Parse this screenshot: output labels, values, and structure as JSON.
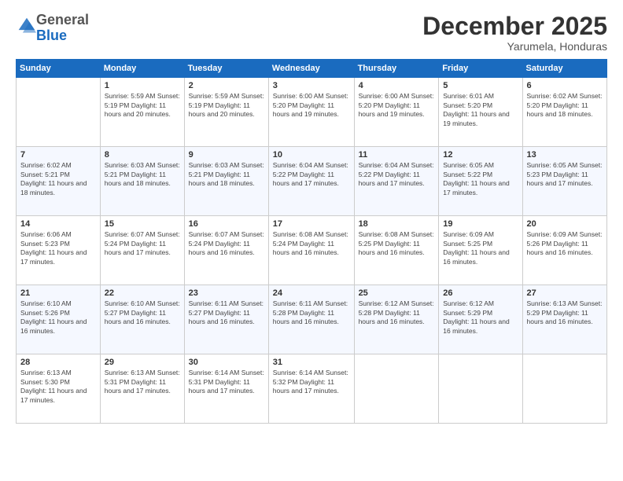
{
  "header": {
    "logo_general": "General",
    "logo_blue": "Blue",
    "month_title": "December 2025",
    "location": "Yarumela, Honduras"
  },
  "weekdays": [
    "Sunday",
    "Monday",
    "Tuesday",
    "Wednesday",
    "Thursday",
    "Friday",
    "Saturday"
  ],
  "weeks": [
    [
      {
        "day": "",
        "info": ""
      },
      {
        "day": "1",
        "info": "Sunrise: 5:59 AM\nSunset: 5:19 PM\nDaylight: 11 hours\nand 20 minutes."
      },
      {
        "day": "2",
        "info": "Sunrise: 5:59 AM\nSunset: 5:19 PM\nDaylight: 11 hours\nand 20 minutes."
      },
      {
        "day": "3",
        "info": "Sunrise: 6:00 AM\nSunset: 5:20 PM\nDaylight: 11 hours\nand 19 minutes."
      },
      {
        "day": "4",
        "info": "Sunrise: 6:00 AM\nSunset: 5:20 PM\nDaylight: 11 hours\nand 19 minutes."
      },
      {
        "day": "5",
        "info": "Sunrise: 6:01 AM\nSunset: 5:20 PM\nDaylight: 11 hours\nand 19 minutes."
      },
      {
        "day": "6",
        "info": "Sunrise: 6:02 AM\nSunset: 5:20 PM\nDaylight: 11 hours\nand 18 minutes."
      }
    ],
    [
      {
        "day": "7",
        "info": "Sunrise: 6:02 AM\nSunset: 5:21 PM\nDaylight: 11 hours\nand 18 minutes."
      },
      {
        "day": "8",
        "info": "Sunrise: 6:03 AM\nSunset: 5:21 PM\nDaylight: 11 hours\nand 18 minutes."
      },
      {
        "day": "9",
        "info": "Sunrise: 6:03 AM\nSunset: 5:21 PM\nDaylight: 11 hours\nand 18 minutes."
      },
      {
        "day": "10",
        "info": "Sunrise: 6:04 AM\nSunset: 5:22 PM\nDaylight: 11 hours\nand 17 minutes."
      },
      {
        "day": "11",
        "info": "Sunrise: 6:04 AM\nSunset: 5:22 PM\nDaylight: 11 hours\nand 17 minutes."
      },
      {
        "day": "12",
        "info": "Sunrise: 6:05 AM\nSunset: 5:22 PM\nDaylight: 11 hours\nand 17 minutes."
      },
      {
        "day": "13",
        "info": "Sunrise: 6:05 AM\nSunset: 5:23 PM\nDaylight: 11 hours\nand 17 minutes."
      }
    ],
    [
      {
        "day": "14",
        "info": "Sunrise: 6:06 AM\nSunset: 5:23 PM\nDaylight: 11 hours\nand 17 minutes."
      },
      {
        "day": "15",
        "info": "Sunrise: 6:07 AM\nSunset: 5:24 PM\nDaylight: 11 hours\nand 17 minutes."
      },
      {
        "day": "16",
        "info": "Sunrise: 6:07 AM\nSunset: 5:24 PM\nDaylight: 11 hours\nand 16 minutes."
      },
      {
        "day": "17",
        "info": "Sunrise: 6:08 AM\nSunset: 5:24 PM\nDaylight: 11 hours\nand 16 minutes."
      },
      {
        "day": "18",
        "info": "Sunrise: 6:08 AM\nSunset: 5:25 PM\nDaylight: 11 hours\nand 16 minutes."
      },
      {
        "day": "19",
        "info": "Sunrise: 6:09 AM\nSunset: 5:25 PM\nDaylight: 11 hours\nand 16 minutes."
      },
      {
        "day": "20",
        "info": "Sunrise: 6:09 AM\nSunset: 5:26 PM\nDaylight: 11 hours\nand 16 minutes."
      }
    ],
    [
      {
        "day": "21",
        "info": "Sunrise: 6:10 AM\nSunset: 5:26 PM\nDaylight: 11 hours\nand 16 minutes."
      },
      {
        "day": "22",
        "info": "Sunrise: 6:10 AM\nSunset: 5:27 PM\nDaylight: 11 hours\nand 16 minutes."
      },
      {
        "day": "23",
        "info": "Sunrise: 6:11 AM\nSunset: 5:27 PM\nDaylight: 11 hours\nand 16 minutes."
      },
      {
        "day": "24",
        "info": "Sunrise: 6:11 AM\nSunset: 5:28 PM\nDaylight: 11 hours\nand 16 minutes."
      },
      {
        "day": "25",
        "info": "Sunrise: 6:12 AM\nSunset: 5:28 PM\nDaylight: 11 hours\nand 16 minutes."
      },
      {
        "day": "26",
        "info": "Sunrise: 6:12 AM\nSunset: 5:29 PM\nDaylight: 11 hours\nand 16 minutes."
      },
      {
        "day": "27",
        "info": "Sunrise: 6:13 AM\nSunset: 5:29 PM\nDaylight: 11 hours\nand 16 minutes."
      }
    ],
    [
      {
        "day": "28",
        "info": "Sunrise: 6:13 AM\nSunset: 5:30 PM\nDaylight: 11 hours\nand 17 minutes."
      },
      {
        "day": "29",
        "info": "Sunrise: 6:13 AM\nSunset: 5:31 PM\nDaylight: 11 hours\nand 17 minutes."
      },
      {
        "day": "30",
        "info": "Sunrise: 6:14 AM\nSunset: 5:31 PM\nDaylight: 11 hours\nand 17 minutes."
      },
      {
        "day": "31",
        "info": "Sunrise: 6:14 AM\nSunset: 5:32 PM\nDaylight: 11 hours\nand 17 minutes."
      },
      {
        "day": "",
        "info": ""
      },
      {
        "day": "",
        "info": ""
      },
      {
        "day": "",
        "info": ""
      }
    ]
  ]
}
